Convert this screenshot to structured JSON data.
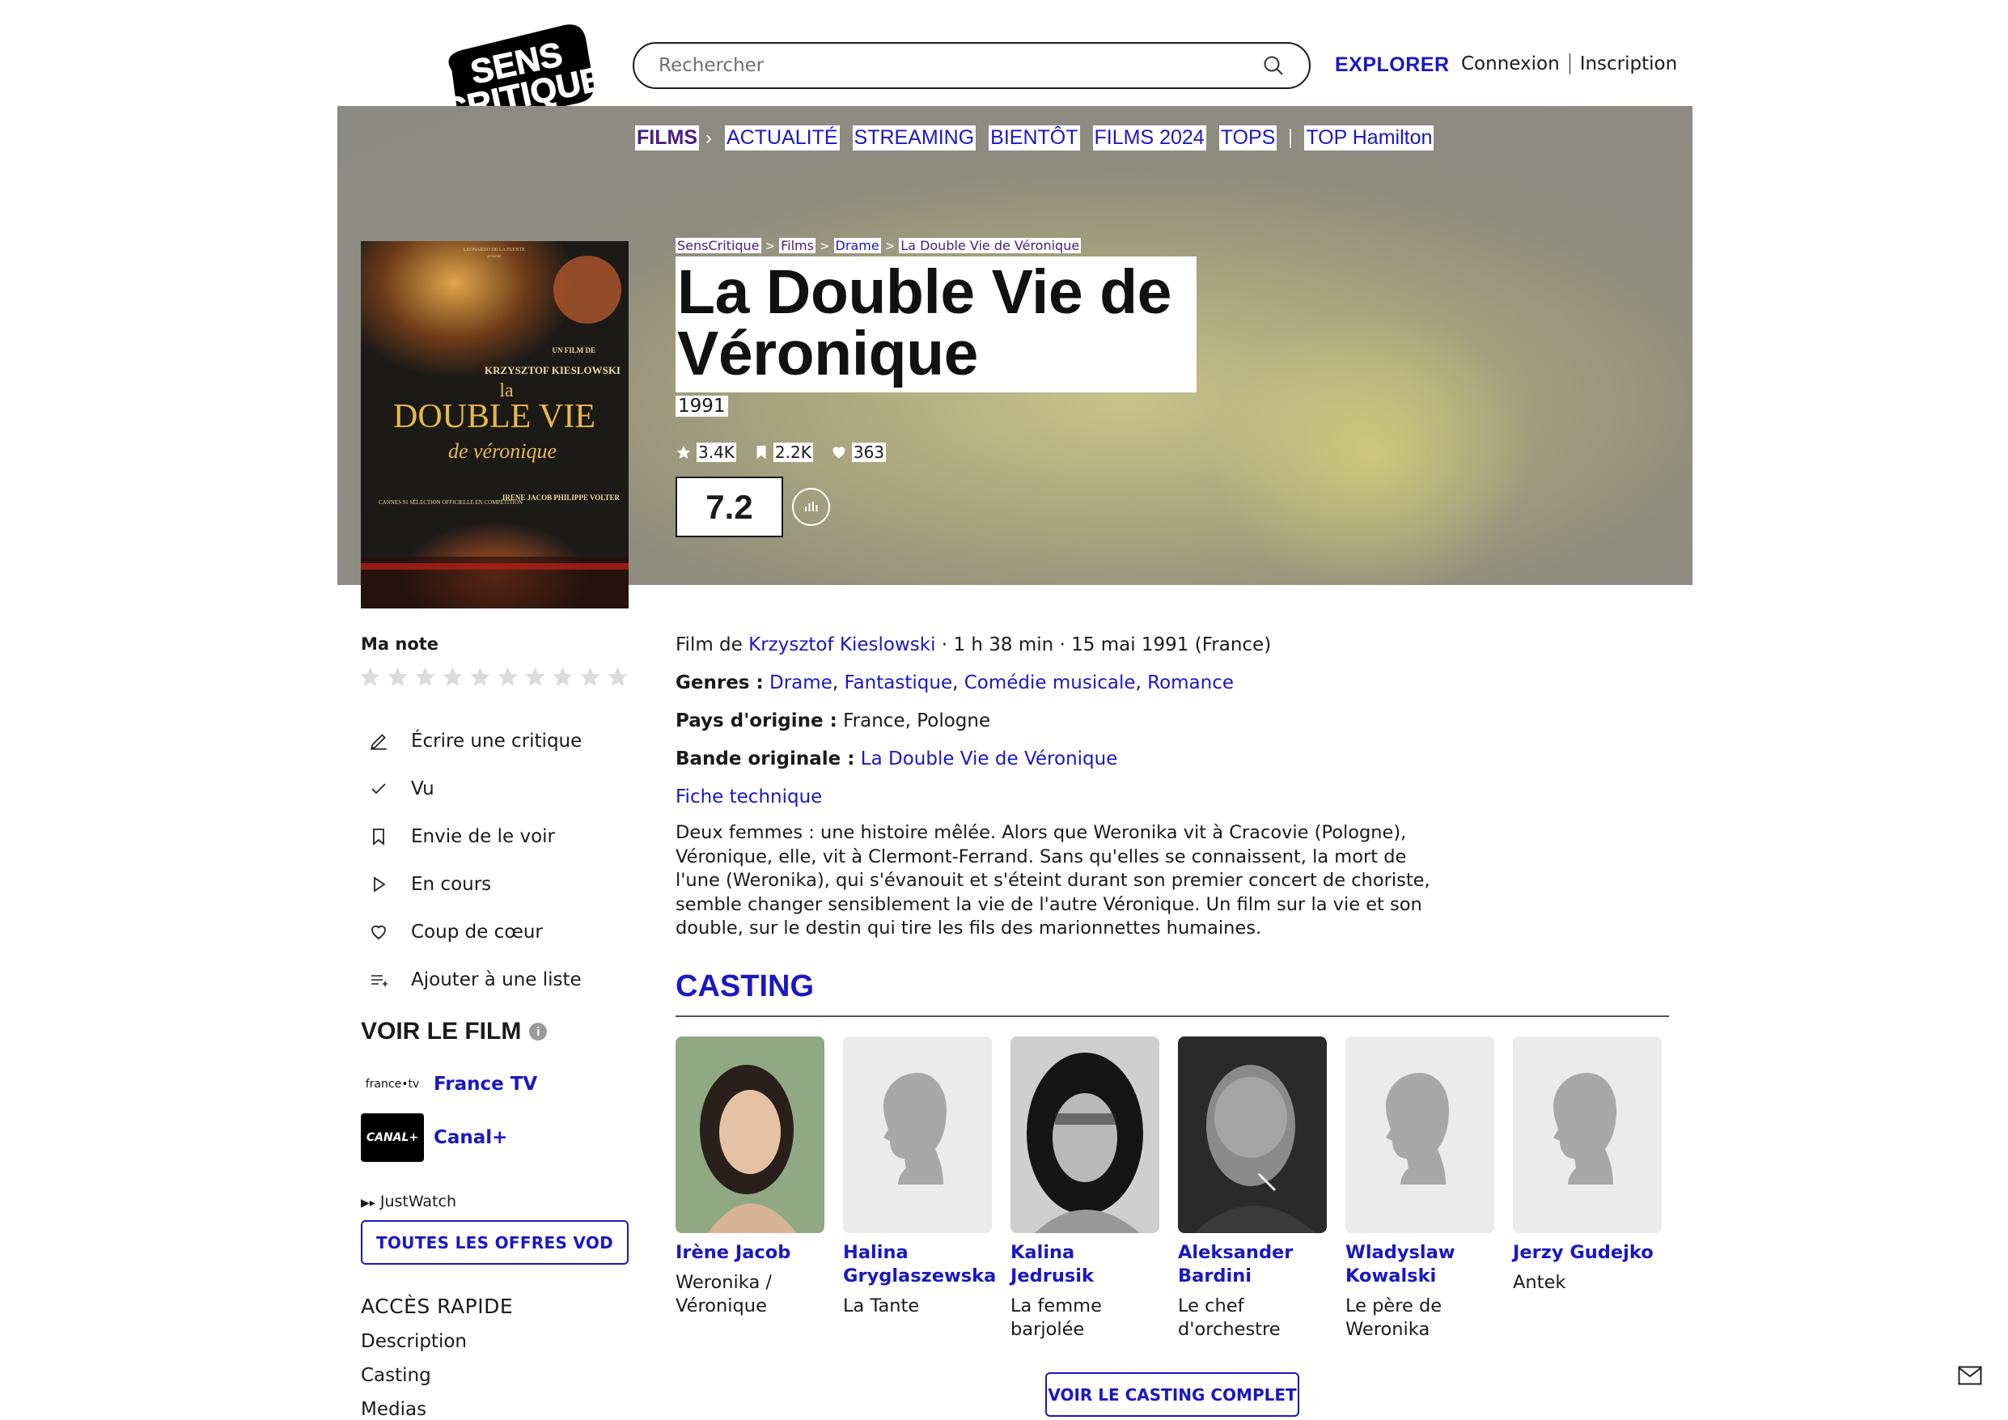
{
  "header": {
    "logo_text": "SENS CRITIQUE",
    "search_placeholder": "Rechercher",
    "explore_label": "EXPLORER",
    "login_label": "Connexion",
    "signup_label": "Inscription"
  },
  "nav": {
    "items": [
      "FILMS",
      "ACTUALITÉ",
      "STREAMING",
      "BIENTÔT",
      "FILMS 2024",
      "TOPS"
    ],
    "extra": "TOP Hamilton"
  },
  "breadcrumb": [
    "SensCritique",
    "Films",
    "Drame",
    "La Double Vie de Véronique"
  ],
  "movie": {
    "title": "La Double Vie de Véronique",
    "year": "1991",
    "ratings_count": "3.4K",
    "wishlist_count": "2.2K",
    "favorites_count": "363",
    "score": "7.2",
    "poster": {
      "producer": "LEONARDO DE LA FUENTE",
      "presents": "présente",
      "film_by": "UN FILM DE",
      "director_caps": "KRZYSZTOF KIESLOWSKI",
      "title_la": "la",
      "title_main": "DOUBLE VIE",
      "title_sub": "de véronique",
      "cast": "IRENE JACOB PHILIPPE VOLTER",
      "festival": "CANNES 91 SÉLECTION OFFICIELLE EN COMPÉTITION"
    }
  },
  "user": {
    "my_rating_label": "Ma note",
    "actions": [
      "Écrire une critique",
      "Vu",
      "Envie de le voir",
      "En cours",
      "Coup de cœur",
      "Ajouter à une liste"
    ]
  },
  "watch": {
    "title": "VOIR LE FILM",
    "providers": [
      {
        "logo": "france•tv",
        "name": "France TV"
      },
      {
        "logo": "CANAL+",
        "name": "Canal+"
      }
    ],
    "justwatch": "JustWatch",
    "all_offers_label": "TOUTES LES OFFRES VOD"
  },
  "quick_access": {
    "title": "ACCÈS RAPIDE",
    "links": [
      "Description",
      "Casting",
      "Medias"
    ]
  },
  "details": {
    "film_by_prefix": "Film de",
    "director": "Krzysztof Kieslowski",
    "meta": "· 1 h 38 min · 15 mai 1991 (France)",
    "genres_label": "Genres :",
    "genres": [
      "Drame",
      "Fantastique",
      "Comédie musicale",
      "Romance"
    ],
    "country_label": "Pays d'origine :",
    "countries": "France, Pologne",
    "soundtrack_label": "Bande originale :",
    "soundtrack": "La Double Vie de Véronique",
    "tech_sheet": "Fiche technique",
    "synopsis": "Deux femmes : une histoire mêlée. Alors que Weronika vit à Cracovie (Pologne), Véronique, elle, vit à Clermont-Ferrand. Sans qu'elles se connaissent, la mort de l'une (Weronika), qui s'évanouit et s'éteint durant son premier concert de choriste, semble changer sensiblement la vie de l'autre Véronique. Un film sur la vie et son double, sur le destin qui tire les fils des marionnettes humaines."
  },
  "casting": {
    "title": "CASTING",
    "members": [
      {
        "name": "Irène Jacob",
        "role": "Weronika / Véronique"
      },
      {
        "name": "Halina Gryglaszewska",
        "role": "La Tante"
      },
      {
        "name": "Kalina Jedrusik",
        "role": "La femme barjolée"
      },
      {
        "name": "Aleksander Bardini",
        "role": "Le chef d'orchestre"
      },
      {
        "name": "Wladyslaw Kowalski",
        "role": "Le père de Weronika"
      },
      {
        "name": "Jerzy Gudejko",
        "role": "Antek"
      }
    ],
    "full_cast_label": "VOIR LE CASTING COMPLET"
  },
  "colors": {
    "accent": "#1a17c4",
    "nav_active": "#4b1d7a",
    "hero_bg": "#8c8a86"
  }
}
